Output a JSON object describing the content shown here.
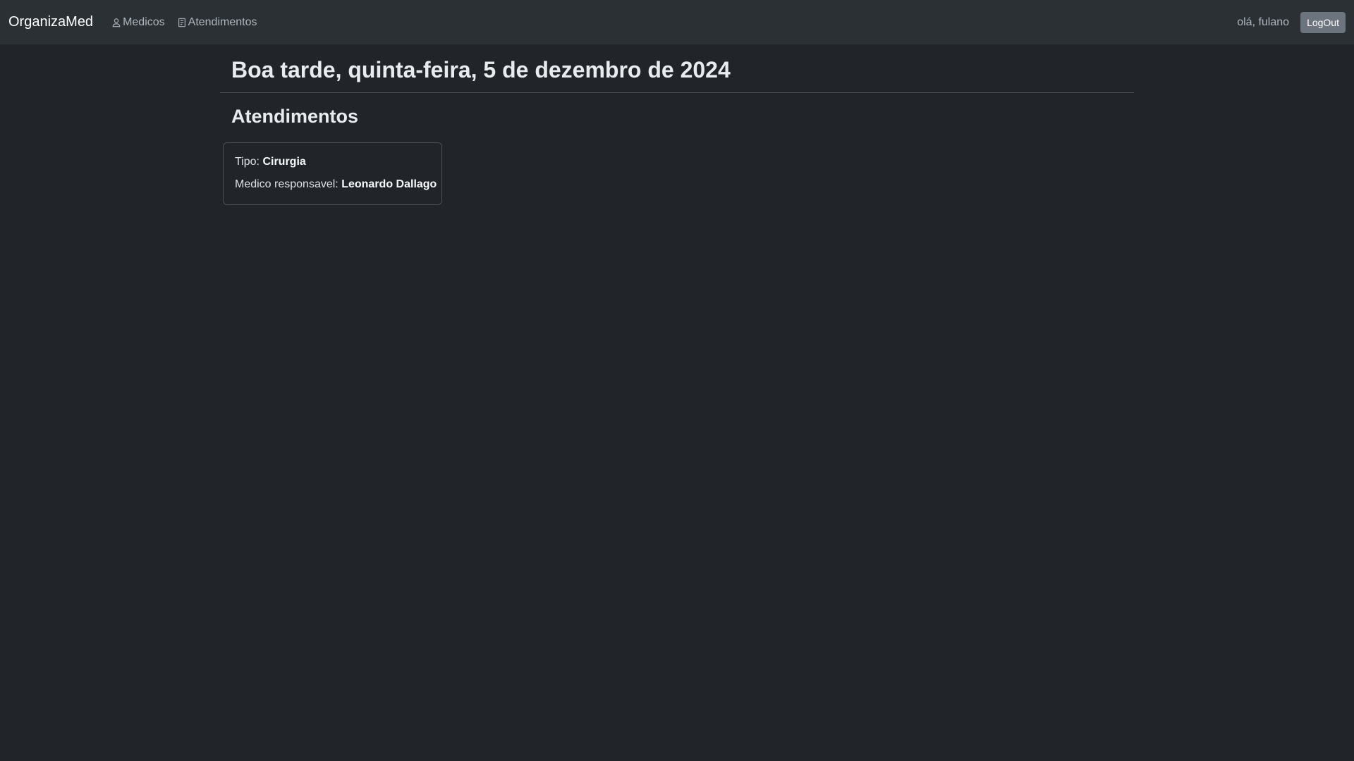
{
  "navbar": {
    "brand": "OrganizaMed",
    "links": [
      {
        "label": "Medicos",
        "icon": "person-icon"
      },
      {
        "label": "Atendimentos",
        "icon": "clipboard-icon"
      }
    ],
    "greeting": "olá, fulano",
    "logout_label": "LogOut"
  },
  "main": {
    "title": "Boa tarde, quinta-feira, 5 de dezembro de 2024",
    "section_title": "Atendimentos",
    "cards": [
      {
        "tipo_label": "Tipo:",
        "tipo_value": "Cirurgia",
        "medico_label": "Medico responsavel:",
        "medico_value": "Leonardo Dallago"
      }
    ]
  },
  "colors": {
    "background": "#212529",
    "navbar": "#2b3035",
    "button": "#6c757d"
  }
}
